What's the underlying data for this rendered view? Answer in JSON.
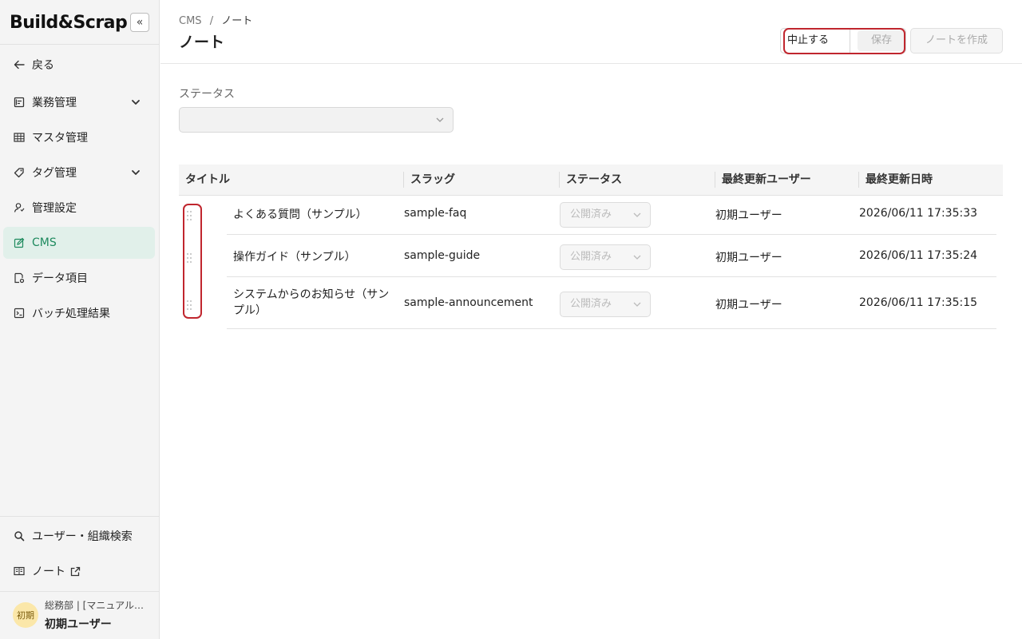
{
  "brand": {
    "name": "Build&Scrap",
    "collapse_label": "«"
  },
  "sidebar": {
    "items": [
      {
        "label": "戻る",
        "icon": "arrow-left-icon"
      },
      {
        "label": "業務管理",
        "icon": "clipboard-icon",
        "expandable": true
      },
      {
        "label": "マスタ管理",
        "icon": "table-icon"
      },
      {
        "label": "タグ管理",
        "icon": "tag-icon",
        "expandable": true
      },
      {
        "label": "管理設定",
        "icon": "user-settings-icon"
      },
      {
        "label": "CMS",
        "icon": "edit-icon",
        "active": true
      },
      {
        "label": "データ項目",
        "icon": "document-settings-icon"
      },
      {
        "label": "バッチ処理結果",
        "icon": "terminal-icon"
      }
    ],
    "bottom_items": [
      {
        "label": "ユーザー・組織検索",
        "icon": "search-icon"
      },
      {
        "label": "ノート",
        "icon": "book-icon",
        "external_icon": "external-link-icon"
      }
    ],
    "user": {
      "avatar_text": "初期",
      "department": "総務部 | [マニュアル…",
      "name": "初期ユーザー"
    }
  },
  "header": {
    "breadcrumb": {
      "root": "CMS",
      "separator": "/",
      "current": "ノート"
    },
    "title": "ノート",
    "cancel_label": "中止する",
    "save_label": "保存",
    "create_label": "ノートを作成"
  },
  "filter": {
    "label": "ステータス",
    "value": ""
  },
  "table": {
    "columns": [
      "タイトル",
      "スラッグ",
      "ステータス",
      "最終更新ユーザー",
      "最終更新日時"
    ],
    "rows": [
      {
        "title": "よくある質問（サンプル）",
        "slug": "sample-faq",
        "status": "公開済み",
        "user": "初期ユーザー",
        "updated": "2026/06/11 17:35:33"
      },
      {
        "title": "操作ガイド（サンプル）",
        "slug": "sample-guide",
        "status": "公開済み",
        "user": "初期ユーザー",
        "updated": "2026/06/11 17:35:24"
      },
      {
        "title": "システムからのお知らせ（サンプル）",
        "slug": "sample-announcement",
        "status": "公開済み",
        "user": "初期ユーザー",
        "updated": "2026/06/11 17:35:15"
      }
    ]
  },
  "colors": {
    "accent": "#1e8a5e",
    "active_bg": "#e1f0ea",
    "highlight": "#c0262e"
  }
}
